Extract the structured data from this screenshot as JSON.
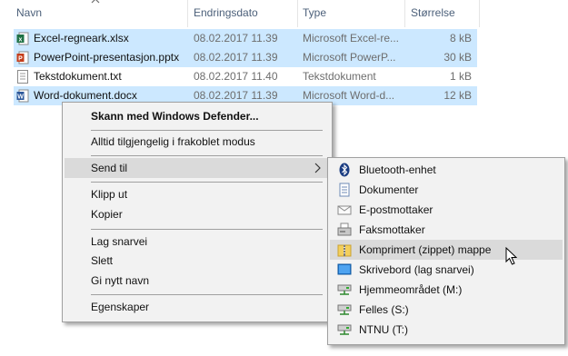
{
  "header": {
    "col_name": "Navn",
    "col_date": "Endringsdato",
    "col_type": "Type",
    "col_size": "Størrelse"
  },
  "files": [
    {
      "name": "Excel-regneark.xlsx",
      "date": "08.02.2017 11.39",
      "type": "Microsoft Excel-re...",
      "size": "8 kB",
      "icon": "excel-file-icon",
      "selected": true
    },
    {
      "name": "PowerPoint-presentasjon.pptx",
      "date": "08.02.2017 11.39",
      "type": "Microsoft PowerP...",
      "size": "30 kB",
      "icon": "powerpoint-file-icon",
      "selected": true
    },
    {
      "name": "Tekstdokument.txt",
      "date": "08.02.2017 11.40",
      "type": "Tekstdokument",
      "size": "1 kB",
      "icon": "text-file-icon",
      "selected": false
    },
    {
      "name": "Word-dokument.docx",
      "date": "08.02.2017 11.39",
      "type": "Microsoft Word-d...",
      "size": "12 kB",
      "icon": "word-file-icon",
      "selected": true
    }
  ],
  "context_menu": {
    "items": [
      "Skann med Windows Defender...",
      "Alltid tilgjengelig i frakoblet modus",
      "Send til",
      "Klipp ut",
      "Kopier",
      "Lag snarvei",
      "Slett",
      "Gi nytt navn",
      "Egenskaper"
    ]
  },
  "send_to_menu": {
    "items": [
      {
        "label": "Bluetooth-enhet",
        "icon": "bluetooth-icon"
      },
      {
        "label": "Dokumenter",
        "icon": "documents-icon"
      },
      {
        "label": "E-postmottaker",
        "icon": "mail-recipient-icon"
      },
      {
        "label": "Faksmottaker",
        "icon": "fax-icon"
      },
      {
        "label": "Komprimert (zippet) mappe",
        "icon": "zip-folder-icon"
      },
      {
        "label": "Skrivebord (lag snarvei)",
        "icon": "desktop-icon"
      },
      {
        "label": "Hjemmeområdet (M:)",
        "icon": "network-drive-icon"
      },
      {
        "label": "Felles (S:)",
        "icon": "network-drive-icon"
      },
      {
        "label": "NTNU (T:)",
        "icon": "network-drive-icon"
      }
    ],
    "highlighted": "Komprimert (zippet) mappe"
  },
  "colors": {
    "selection": "#cce8ff",
    "menu_bg": "#f2f2f2",
    "menu_hover": "#dadada",
    "header_text": "#4c607a"
  }
}
